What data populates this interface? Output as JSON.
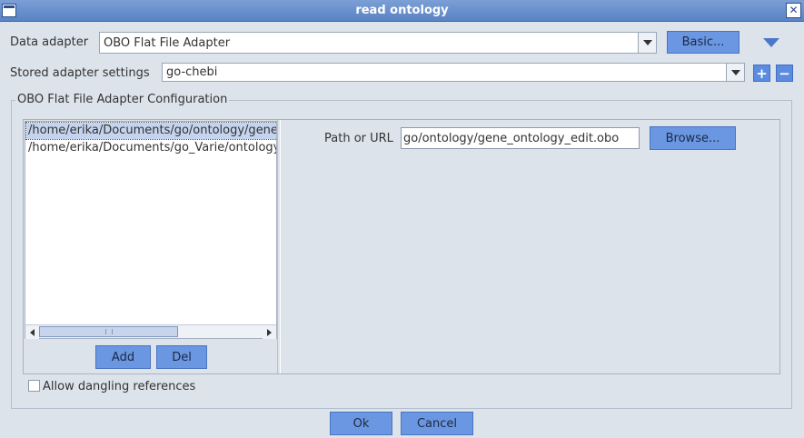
{
  "window": {
    "title": "read ontology",
    "close_glyph": "✕"
  },
  "colors": {
    "title_bar": "#5a83c5",
    "button": "#6b96e2",
    "background": "#dde3ea",
    "selection": "#c4d4ef"
  },
  "data_adapter": {
    "label": "Data adapter",
    "value": "OBO Flat File Adapter",
    "basic_button": "Basic..."
  },
  "stored_settings": {
    "label": "Stored adapter settings",
    "value": "go-chebi",
    "add_glyph": "+",
    "remove_glyph": "−"
  },
  "config": {
    "group_title": "OBO Flat File Adapter Configuration",
    "paths": [
      "/home/erika/Documents/go/ontology/gene_ontology_edit.obo",
      "/home/erika/Documents/go_Varie/ontology"
    ],
    "add_button": "Add",
    "del_button": "Del",
    "path_label": "Path or URL",
    "path_value": "go/ontology/gene_ontology_edit.obo",
    "browse_button": "Browse..."
  },
  "dangling": {
    "label": "Allow dangling references",
    "checked": false
  },
  "footer": {
    "ok_button": "Ok",
    "cancel_button": "Cancel"
  },
  "icons": [
    "window-menu-icon",
    "close-icon",
    "chevron-down-icon",
    "expand-toggle-icon",
    "plus-icon",
    "minus-icon",
    "scroll-left-icon",
    "scroll-right-icon"
  ]
}
